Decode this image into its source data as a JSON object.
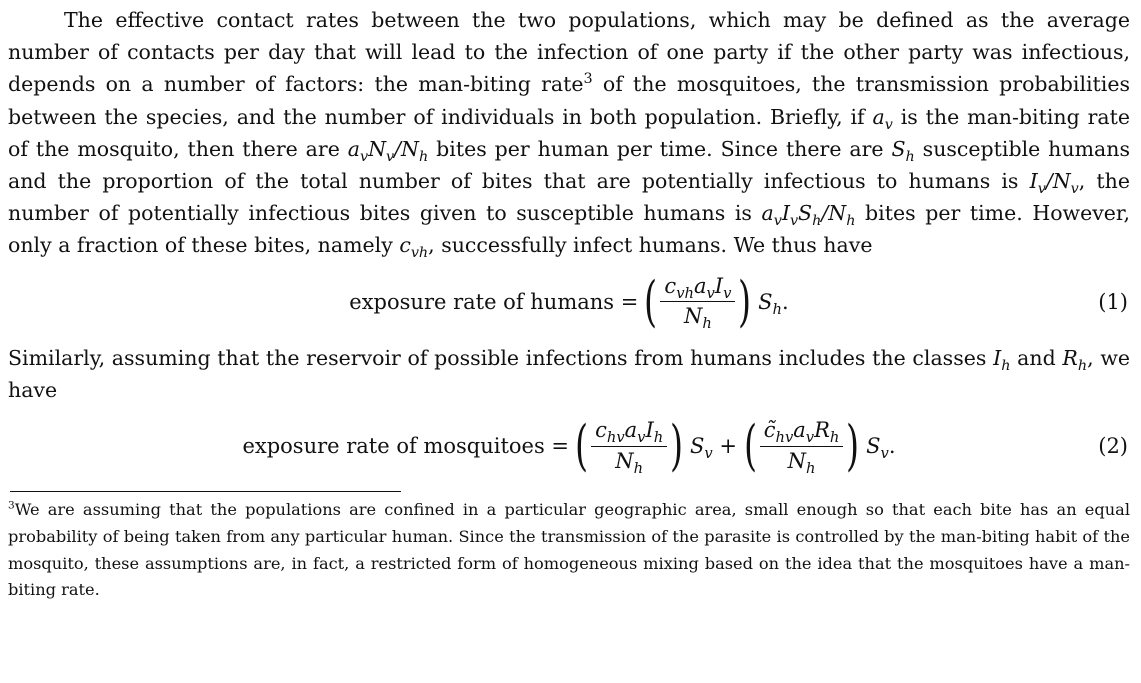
{
  "paragraph1": {
    "s1": "The effective contact rates between the two populations, which may be defined as the average number of contacts per day that will lead to the infection of one party if the other party was infectious, depends on a number of factors: the man-biting rate",
    "fnref": "3",
    "s2": " of the mosquitoes, the transmission probabilities between the species, and the number of individuals in both population. Briefly, if ",
    "s3": " is the man-biting rate of the mosquito, then there are ",
    "s4": " bites per human per time. Since there are ",
    "s5": " susceptible humans and the proportion of the total number of bites that are potentially infectious to humans is ",
    "s6": ", the number of potentially infectious bites given to susceptible humans is ",
    "s7": " bites per time. However, only a fraction of these bites, namely ",
    "s8": ", successfully infect humans. We thus have"
  },
  "equation1": {
    "label": "exposure rate of humans =",
    "number": "(1)"
  },
  "paragraph2": {
    "s1": "Similarly, assuming that the reservoir of possible infections from humans includes the classes ",
    "s2": " and ",
    "s3": ", we have"
  },
  "equation2": {
    "label": "exposure rate of mosquitoes =",
    "number": "(2)"
  },
  "footnote": {
    "marker": "3",
    "text": "We are assuming that the populations are confined in a particular geographic area, small enough so that each bite has an equal probability of being taken from any particular human. Since the transmission of the parasite is controlled by the man-biting habit of the mosquito, these assumptions are, in fact, a restricted form of homogeneous mixing based on the idea that the mosquitoes have a man-biting rate."
  }
}
